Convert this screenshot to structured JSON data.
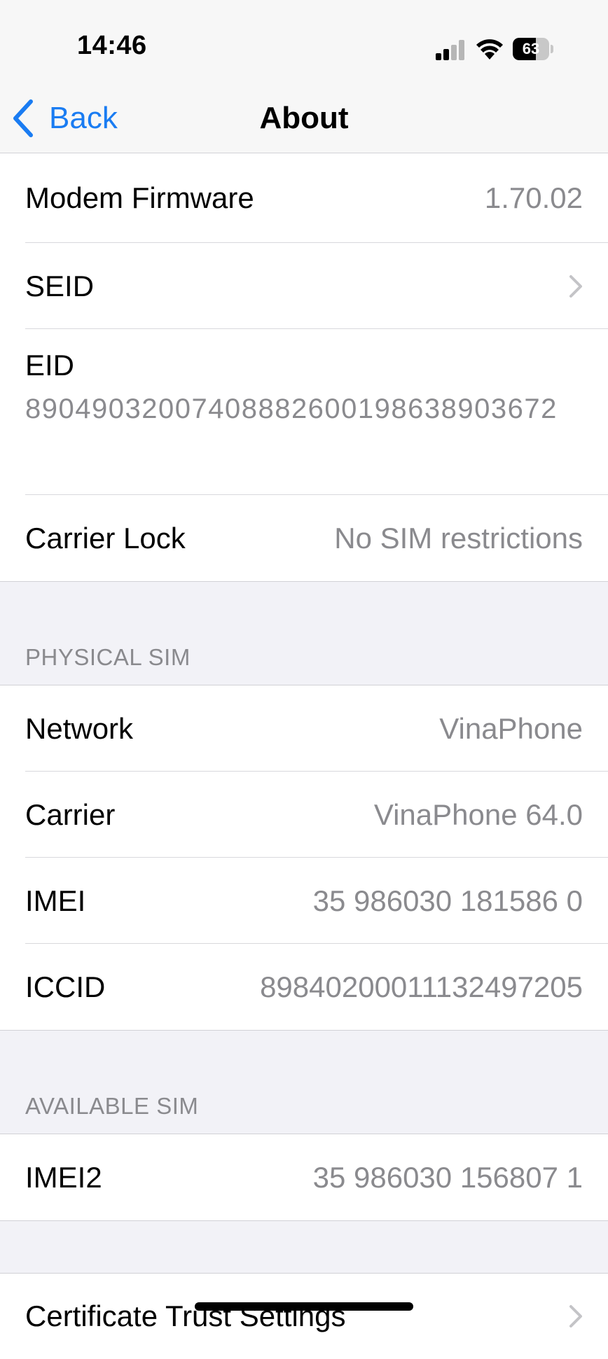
{
  "status_bar": {
    "time": "14:46",
    "battery_percent": "63",
    "battery_level": 0.63,
    "signal_bars_active": 2,
    "signal_bars_total": 4
  },
  "nav": {
    "back_label": "Back",
    "title": "About"
  },
  "device_rows": [
    {
      "label": "Modem Firmware",
      "value": "1.70.02"
    },
    {
      "label": "SEID",
      "value": ""
    }
  ],
  "eid": {
    "label": "EID",
    "value": "89049032007408882600198638903672"
  },
  "carrier_lock": {
    "label": "Carrier Lock",
    "value": "No SIM restrictions"
  },
  "physical_sim": {
    "header": "PHYSICAL SIM",
    "rows": [
      {
        "label": "Network",
        "value": "VinaPhone"
      },
      {
        "label": "Carrier",
        "value": "VinaPhone 64.0"
      },
      {
        "label": "IMEI",
        "value": "35 986030 181586 0"
      },
      {
        "label": "ICCID",
        "value": "89840200011132497205"
      }
    ]
  },
  "available_sim": {
    "header": "AVAILABLE SIM",
    "rows": [
      {
        "label": "IMEI2",
        "value": "35 986030 156807 1"
      }
    ]
  },
  "certificate": {
    "label": "Certificate Trust Settings"
  },
  "colors": {
    "accent": "#1a7cf2",
    "secondary_text": "#8a8a8e",
    "grouped_background": "#f2f2f7"
  }
}
